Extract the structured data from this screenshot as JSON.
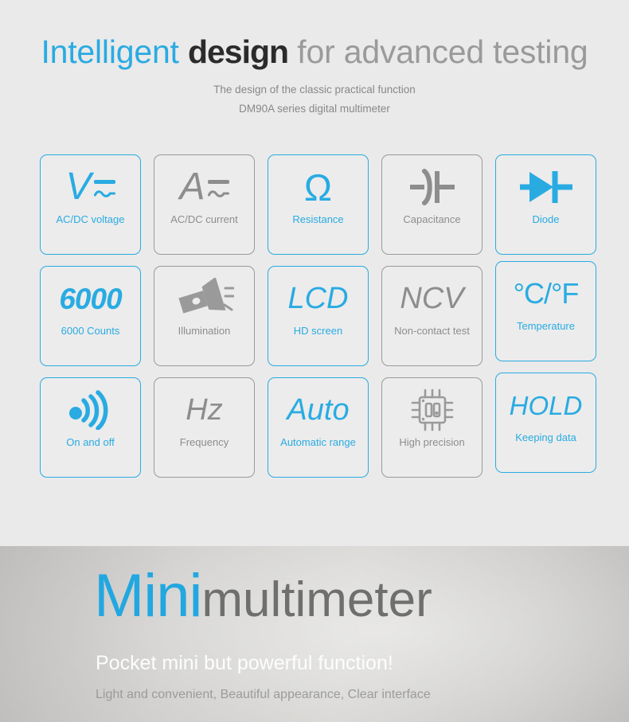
{
  "header": {
    "title_part1": "Intelligent",
    "title_part2": "design",
    "title_part3": "for advanced testing",
    "subtitle1": "The design of the classic practical function",
    "subtitle2": "DM90A  series digital multimeter"
  },
  "colors": {
    "accent_blue": "#29abe2",
    "gray_text": "#8d8d8d",
    "page_bg": "#eaeaea",
    "card_bg": "#ececec",
    "gray_border": "#9a9a9a"
  },
  "features": [
    {
      "icon": "voltage-ac-dc-icon",
      "glyph": "V",
      "label": "AC/DC voltage",
      "highlight": true
    },
    {
      "icon": "current-ac-dc-icon",
      "glyph": "A",
      "label": "AC/DC current",
      "highlight": false
    },
    {
      "icon": "resistance-omega-icon",
      "glyph": "Ω",
      "label": "Resistance",
      "highlight": true
    },
    {
      "icon": "capacitance-icon",
      "glyph": "",
      "label": "Capacitance",
      "highlight": false
    },
    {
      "icon": "diode-icon",
      "glyph": "",
      "label": "Diode",
      "highlight": true
    },
    {
      "icon": "counts-6000-icon",
      "glyph": "6000",
      "label": "6000 Counts",
      "highlight": true
    },
    {
      "icon": "flashlight-icon",
      "glyph": "",
      "label": "Illumination",
      "highlight": false
    },
    {
      "icon": "lcd-icon",
      "glyph": "LCD",
      "label": "HD screen",
      "highlight": true
    },
    {
      "icon": "ncv-icon",
      "glyph": "NCV",
      "label": "Non-contact test",
      "highlight": false
    },
    {
      "icon": "temperature-icon",
      "glyph": "°C/°F",
      "label": "Temperature",
      "highlight": true
    },
    {
      "icon": "buzzer-sound-icon",
      "glyph": "",
      "label": "On and off",
      "highlight": true
    },
    {
      "icon": "frequency-hz-icon",
      "glyph": "Hz",
      "label": "Frequency",
      "highlight": false
    },
    {
      "icon": "auto-range-icon",
      "glyph": "Auto",
      "label": "Automatic range",
      "highlight": true
    },
    {
      "icon": "chip-precision-icon",
      "glyph": "",
      "label": "High precision",
      "highlight": false
    },
    {
      "icon": "hold-icon",
      "glyph": "HOLD",
      "label": "Keeping data",
      "highlight": true
    }
  ],
  "banner": {
    "title_blue": "Mini",
    "title_gray": "multimeter",
    "tagline": "Pocket mini but powerful function!",
    "subtitle": "Light and convenient, Beautiful appearance, Clear interface"
  }
}
